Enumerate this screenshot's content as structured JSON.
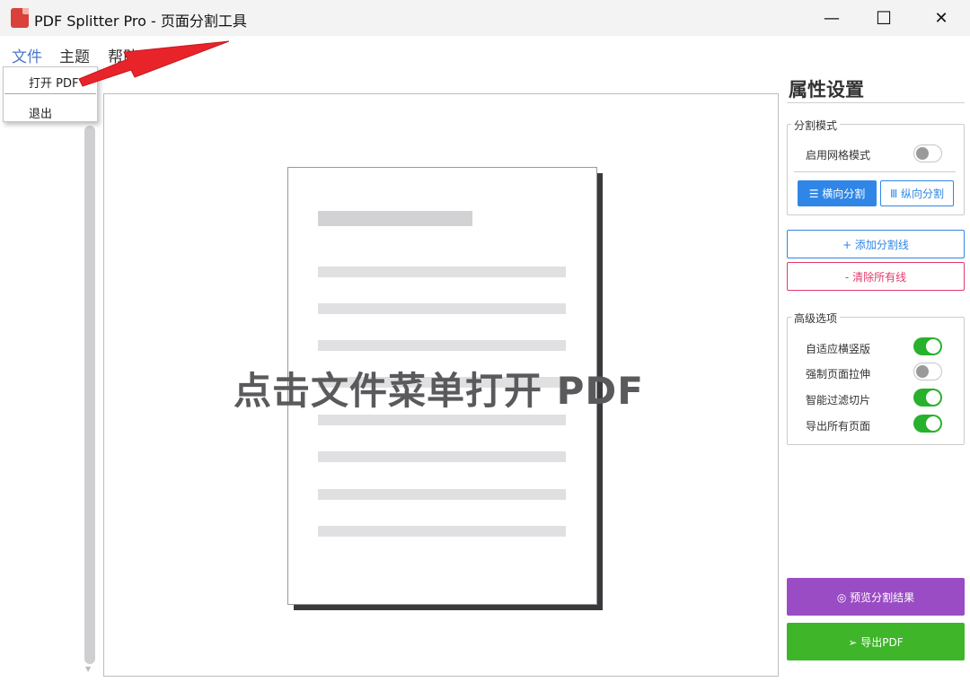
{
  "window": {
    "title": "PDF Splitter Pro - 页面分割工具",
    "minimize_glyph": "—",
    "maximize_glyph": "☐",
    "close_glyph": "✕"
  },
  "menubar": {
    "file": "文件",
    "theme": "主题",
    "help": "帮助"
  },
  "file_menu": {
    "open_pdf": "打开 PDF",
    "exit": "退出"
  },
  "canvas": {
    "hint": "点击文件菜单打开 PDF"
  },
  "panel": {
    "title": "属性设置",
    "split_mode": {
      "label": "分割模式",
      "grid_mode_label": "启用网格模式",
      "grid_mode_on": false,
      "horizontal_button": "☰ 横向分割",
      "vertical_button": "Ⅲ 纵向分割",
      "active": "horizontal"
    },
    "add_line_button": "+ 添加分割线",
    "clear_lines_button": "- 清除所有线",
    "advanced": {
      "label": "高级选项",
      "options": [
        {
          "label": "自适应横竖版",
          "on": true
        },
        {
          "label": "强制页面拉伸",
          "on": false
        },
        {
          "label": "智能过滤切片",
          "on": true
        },
        {
          "label": "导出所有页面",
          "on": true
        }
      ]
    },
    "preview_button": "◎ 预览分割结果",
    "export_button": "➢ 导出PDF"
  },
  "colors": {
    "accent_blue": "#2f86e6",
    "danger_pink": "#e23a6b",
    "preview_purple": "#9a4cc4",
    "export_green": "#3fb52a",
    "toggle_on_green": "#28b12c",
    "annotation_red": "#e8242a"
  },
  "icons": {
    "app": "pdf-file-icon",
    "annotation": "red-arrow-icon"
  }
}
